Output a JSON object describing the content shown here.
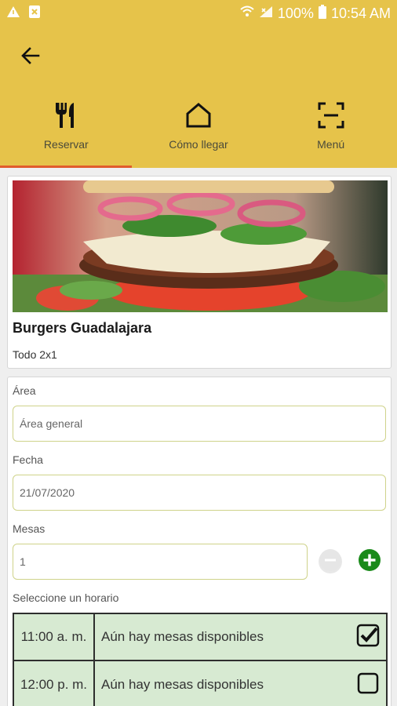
{
  "status_bar": {
    "battery": "100%",
    "time": "10:54 AM",
    "icons": [
      "warning-icon",
      "sim-icon",
      "wifi-icon",
      "signal-icon",
      "battery-icon"
    ]
  },
  "app_bar": {
    "back_icon": "arrow-back-icon",
    "color": "#e6c34a"
  },
  "tabs": [
    {
      "label": "Reservar",
      "icon": "utensils-icon",
      "active": true
    },
    {
      "label": "Cómo llegar",
      "icon": "home-icon",
      "active": false
    },
    {
      "label": "Menú",
      "icon": "scan-icon",
      "active": false
    }
  ],
  "restaurant": {
    "name": "Burgers Guadalajara",
    "promo": "Todo 2x1",
    "image": "burger-photo"
  },
  "form": {
    "area_label": "Área",
    "area_value": "Área general",
    "fecha_label": "Fecha",
    "fecha_value": "21/07/2020",
    "mesas_label": "Mesas",
    "mesas_value": "1",
    "horario_label": "Seleccione un horario"
  },
  "slots": [
    {
      "time": "11:00 a. m.",
      "status": "Aún hay mesas disponibles",
      "checked": true
    },
    {
      "time": "12:00 p. m.",
      "status": "Aún hay mesas disponibles",
      "checked": false
    }
  ],
  "colors": {
    "accent": "#e6c34a",
    "tab_indicator": "#e15b2c",
    "slot_bg": "#d7ead2",
    "add_green": "#1a8a1a"
  }
}
